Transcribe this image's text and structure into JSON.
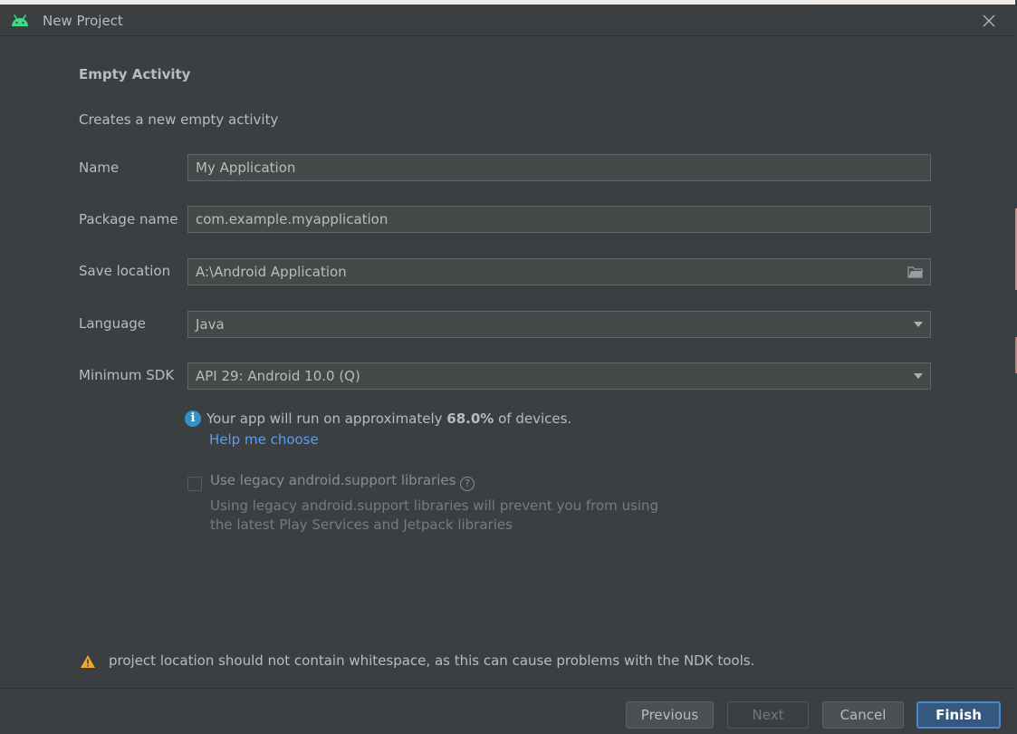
{
  "window": {
    "title": "New Project",
    "app_icon": "android-icon",
    "close_icon": "close-icon"
  },
  "template": {
    "heading": "Empty Activity",
    "description": "Creates a new empty activity"
  },
  "form": {
    "name": {
      "label": "Name",
      "value": "My Application"
    },
    "package": {
      "label": "Package name",
      "value": "com.example.myapplication"
    },
    "save_location": {
      "label": "Save location",
      "value": "A:\\Android Application",
      "icon": "folder-icon"
    },
    "language": {
      "label": "Language",
      "value": "Java"
    },
    "min_sdk": {
      "label": "Minimum SDK",
      "value": "API 29: Android 10.0 (Q)"
    }
  },
  "info": {
    "prefix": "Your app will run on approximately ",
    "percent": "68.0%",
    "suffix": " of devices.",
    "help_link": "Help me choose"
  },
  "legacy": {
    "label": "Use legacy android.support libraries",
    "checked": false,
    "help_line1": "Using legacy android.support libraries will prevent you from using",
    "help_line2": "the latest Play Services and Jetpack libraries"
  },
  "warning": {
    "text": "project location should not contain whitespace, as this can cause problems with the NDK tools."
  },
  "buttons": {
    "previous": "Previous",
    "next": "Next",
    "cancel": "Cancel",
    "finish": "Finish"
  },
  "colors": {
    "background": "#3c3f41",
    "field_bg": "#45494a",
    "link": "#589df6",
    "primary_button": "#365880",
    "android_green": "#3ddc84",
    "warning": "#f0a732",
    "info": "#3592c4"
  }
}
